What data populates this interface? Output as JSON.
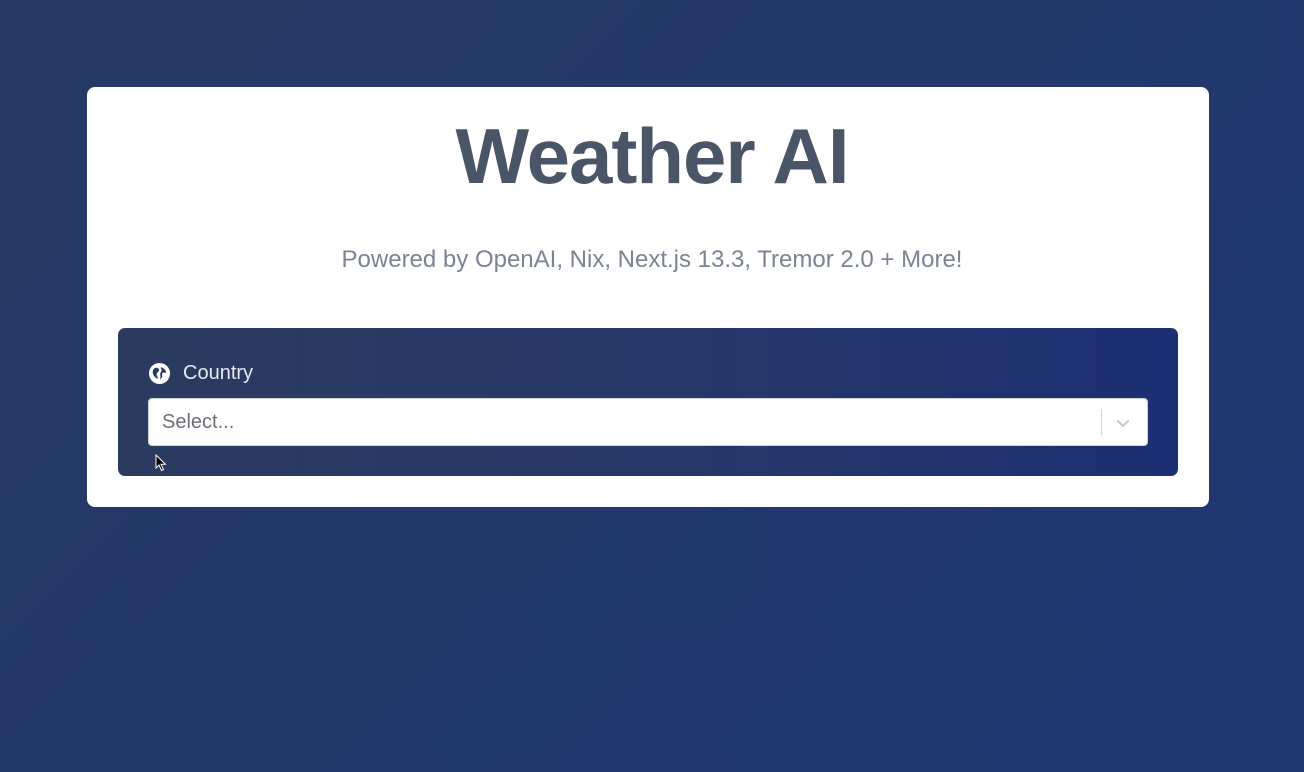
{
  "header": {
    "title": "Weather AI",
    "subtitle": "Powered by OpenAI, Nix, Next.js 13.3, Tremor 2.0 + More!"
  },
  "country_field": {
    "label": "Country",
    "icon": "globe-icon",
    "placeholder": "Select...",
    "dropdown_icon": "chevron-down-icon"
  },
  "colors": {
    "background": "#22386a",
    "card": "#ffffff",
    "title": "#4a5568",
    "subtitle": "#7b8394",
    "panel": "#25376b",
    "label": "#e6e9f0"
  }
}
